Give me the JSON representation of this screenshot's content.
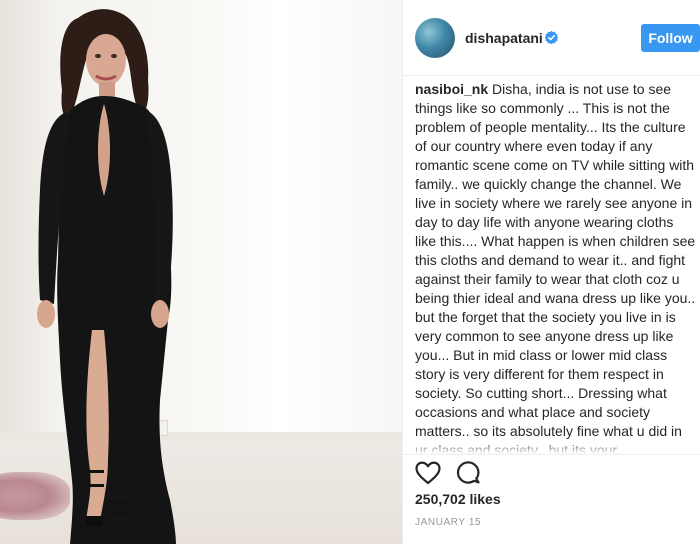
{
  "header": {
    "username": "dishapatani",
    "follow_label": "Follow"
  },
  "comment": {
    "author": "nasiboi_nk",
    "text": "Disha, india is not use to see things like so commonly ... This is not the problem of people mentality... Its the culture of our country where even today if any romantic scene come on TV while sitting with family.. we quickly change the channel. We live in society where we rarely see anyone in day to day life with anyone wearing cloths like this.... What happen is when children see this cloths and demand to wear it.. and fight against their family to wear that cloth coz u being thier ideal and wana dress up like you.. but the forget that the society you live in is very common to see anyone dress up like you... But in mid class or lower mid class story is very different for them respect in society. So cutting short... Dressing what occasions and what place and society matters.. so its absolutely fine what u did in ur class and society.. but its your responsibility that if a"
  },
  "actions": {
    "likes": "250,702 likes",
    "date": "JANUARY 15"
  },
  "colors": {
    "follow_button": "#3897f0",
    "verified_badge": "#3897f0",
    "text": "#262626",
    "muted": "#999999",
    "dress": "#121212"
  },
  "icons": [
    "verified-badge-icon",
    "heart-icon",
    "comment-icon"
  ]
}
